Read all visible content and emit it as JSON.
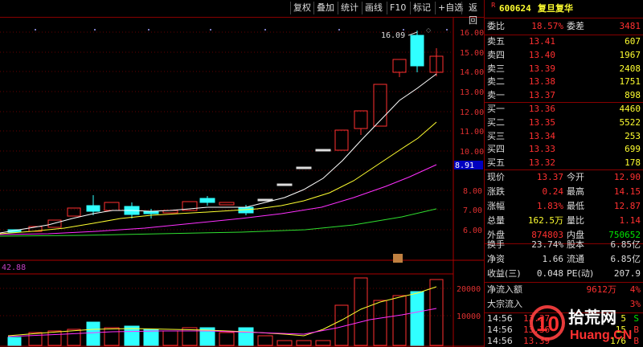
{
  "toolbar": {
    "buttons": [
      "复权",
      "叠加",
      "统计",
      "画线",
      "F10",
      "标记",
      "+自选",
      "返回"
    ]
  },
  "price_axis": {
    "ticks": [
      "16.00",
      "15.00",
      "14.00",
      "13.00",
      "12.00",
      "11.00",
      "10.00",
      "9.00",
      "8.00",
      "7.00",
      "6.00"
    ],
    "current_marker": "8.91",
    "peak_label": "16.09"
  },
  "volume_axis": {
    "ticks": [
      "20000",
      "10000"
    ],
    "left_label": "42.88"
  },
  "stock": {
    "flag": "R",
    "code": "600624",
    "name": "复旦复华"
  },
  "ratio": {
    "label1": "委比",
    "val1": "18.57%",
    "label2": "委差",
    "val2": "3481"
  },
  "sell": [
    {
      "label": "卖五",
      "price": "13.41",
      "qty": "607"
    },
    {
      "label": "卖四",
      "price": "13.40",
      "qty": "1967"
    },
    {
      "label": "卖三",
      "price": "13.39",
      "qty": "2408"
    },
    {
      "label": "卖二",
      "price": "13.38",
      "qty": "1751"
    },
    {
      "label": "卖一",
      "price": "13.37",
      "qty": "898"
    }
  ],
  "buy": [
    {
      "label": "买一",
      "price": "13.36",
      "qty": "4460"
    },
    {
      "label": "买二",
      "price": "13.35",
      "qty": "5522"
    },
    {
      "label": "买三",
      "price": "13.34",
      "qty": "253"
    },
    {
      "label": "买四",
      "price": "13.33",
      "qty": "699"
    },
    {
      "label": "买五",
      "price": "13.32",
      "qty": "178"
    }
  ],
  "quote": {
    "now_label": "现价",
    "now": "13.37",
    "open_label": "今开",
    "open": "12.90",
    "chg_label": "涨跌",
    "chg": "0.24",
    "high_label": "最高",
    "high": "14.15",
    "pct_label": "涨幅",
    "pct": "1.83%",
    "low_label": "最低",
    "low": "12.87",
    "vol_label": "总量",
    "vol": "162.5万",
    "vr_label": "量比",
    "vr": "1.14",
    "out_label": "外盘",
    "out": "874803",
    "in_label": "内盘",
    "in": "750652"
  },
  "fund": {
    "turn_label": "换手",
    "turn": "23.74%",
    "cap_label": "股本",
    "cap": "6.85亿",
    "nav_label": "净资",
    "nav": "1.66",
    "float_label": "流通",
    "float": "6.85亿",
    "eps_label": "收益(三)",
    "eps": "0.048",
    "pe_label": "PE(动)",
    "pe": "207.9"
  },
  "flow": {
    "net_label": "净流入额",
    "net": "9612万",
    "net_pct": "4%",
    "big_label": "大宗流入",
    "big_pct": "3%"
  },
  "ticks": [
    {
      "time": "14:56",
      "price": "13.37",
      "vol": "5",
      "side": "S"
    },
    {
      "time": "14:56",
      "price": "13.36",
      "vol": "15",
      "side": "B"
    },
    {
      "time": "14:56",
      "price": "13.39",
      "vol": "176",
      "side": "B"
    }
  ],
  "watermark": {
    "brand": "拾荒网",
    "url": "Huang.CN",
    "number": "10"
  },
  "colors": {
    "up": "#ff3030",
    "down": "#30ffff",
    "ma5": "#ffffff",
    "ma10": "#ffff30",
    "ma20": "#ff30ff",
    "ma60": "#30e030"
  }
}
